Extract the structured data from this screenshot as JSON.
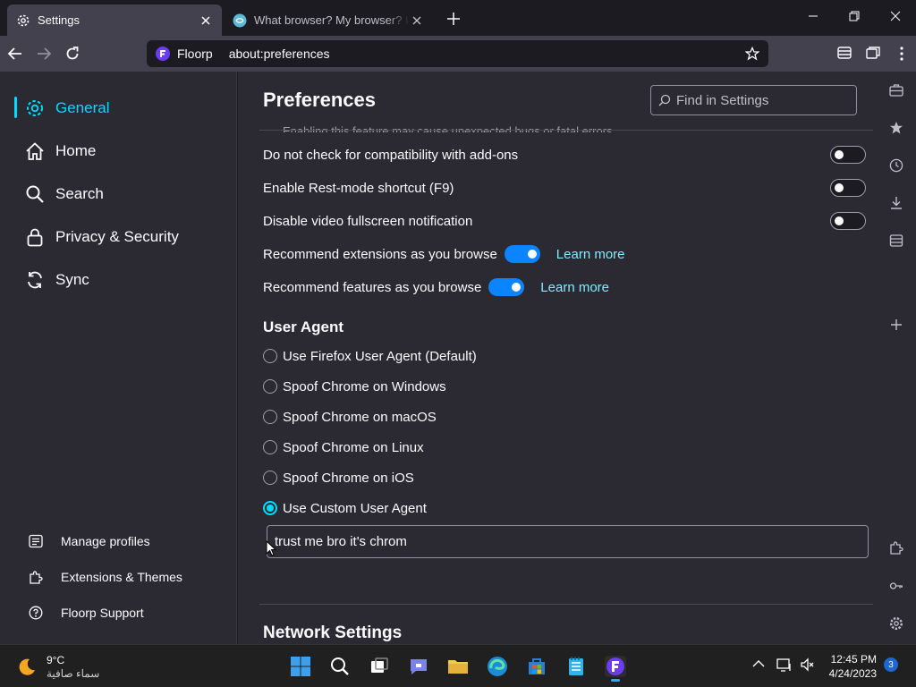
{
  "tabs": [
    {
      "label": "Settings",
      "icon": "gear-icon",
      "active": true
    },
    {
      "label": "What browser? My browser? Is my",
      "icon": "globe-icon",
      "active": false
    }
  ],
  "toolbar": {
    "brand": "Floorp",
    "url": "about:preferences"
  },
  "sidebar": {
    "categories": [
      {
        "label": "General",
        "icon": "gear-icon",
        "selected": true
      },
      {
        "label": "Home",
        "icon": "home-icon"
      },
      {
        "label": "Search",
        "icon": "search-icon"
      },
      {
        "label": "Privacy & Security",
        "icon": "lock-icon"
      },
      {
        "label": "Sync",
        "icon": "sync-icon"
      }
    ],
    "bottom_links": [
      {
        "label": "Manage profiles",
        "icon": "profile-icon"
      },
      {
        "label": "Extensions & Themes",
        "icon": "puzzle-icon"
      },
      {
        "label": "Floorp Support",
        "icon": "help-icon"
      }
    ]
  },
  "main": {
    "title": "Preferences",
    "search_placeholder": "Find in Settings",
    "cut_text": "Enabling this feature may cause unexpected bugs or fatal errors",
    "toggles": [
      {
        "label": "Do not check for compatibility with add-ons",
        "on": false
      },
      {
        "label": "Enable Rest-mode shortcut (F9)",
        "on": false
      },
      {
        "label": "Disable video fullscreen notification",
        "on": false
      }
    ],
    "recommend": [
      {
        "label": "Recommend extensions as you browse",
        "on": true,
        "link": "Learn more"
      },
      {
        "label": "Recommend features as you browse",
        "on": true,
        "link": "Learn more"
      }
    ],
    "user_agent": {
      "heading": "User Agent",
      "options": [
        "Use Firefox User Agent (Default)",
        "Spoof Chrome on Windows",
        "Spoof Chrome on macOS",
        "Spoof Chrome on Linux",
        "Spoof Chrome on iOS",
        "Use Custom User Agent"
      ],
      "selected_index": 5,
      "custom_value": "trust me bro it's chrom"
    },
    "network_heading": "Network Settings"
  },
  "taskbar": {
    "temp": "9°C",
    "weather_text": "سماء صافية",
    "time": "12:45 PM",
    "date": "4/24/2023",
    "notif_count": "3"
  },
  "colors": {
    "accent": "#00ddff",
    "toggle_on": "#0a84ff",
    "bg": "#2b2a33"
  }
}
